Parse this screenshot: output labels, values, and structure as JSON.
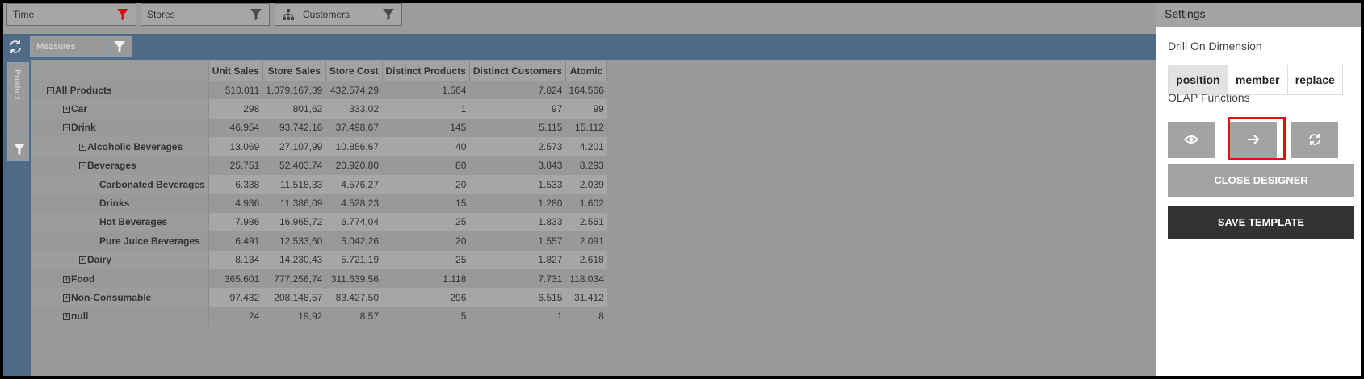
{
  "filters": [
    {
      "label": "Time",
      "icon": "filter-icon",
      "color": "#d0101b"
    },
    {
      "label": "Stores",
      "icon": "filter-icon",
      "color": "#4a4a4a"
    },
    {
      "label": "Customers",
      "icon": "filter-icon",
      "color": "#4a4a4a"
    }
  ],
  "measures_bar": {
    "label": "Measures"
  },
  "left_bar": {
    "product_label": "Product"
  },
  "table": {
    "columns": [
      "Unit Sales",
      "Store Sales",
      "Store Cost",
      "Distinct Products",
      "Distinct Customers",
      "Atomic"
    ],
    "rows": [
      {
        "label": "All Products",
        "toggle": "⊟",
        "level": 0,
        "values": [
          "510.011",
          "1.079.167,39",
          "432.574,29",
          "1.564",
          "7.824",
          "164.566"
        ]
      },
      {
        "label": "Car",
        "toggle": "⊞",
        "level": 1,
        "values": [
          "298",
          "801,62",
          "333,02",
          "1",
          "97",
          "99"
        ]
      },
      {
        "label": "Drink",
        "toggle": "⊟",
        "level": 1,
        "values": [
          "46.954",
          "93.742,16",
          "37.498,67",
          "145",
          "5.115",
          "15.112"
        ]
      },
      {
        "label": "Alcoholic Beverages",
        "toggle": "⊞",
        "level": 2,
        "values": [
          "13.069",
          "27.107,99",
          "10.856,67",
          "40",
          "2.573",
          "4.201"
        ]
      },
      {
        "label": "Beverages",
        "toggle": "⊟",
        "level": 2,
        "values": [
          "25.751",
          "52.403,74",
          "20.920,80",
          "80",
          "3.843",
          "8.293"
        ]
      },
      {
        "label": "Carbonated Beverages",
        "toggle": "",
        "level": 3,
        "values": [
          "6.338",
          "11.518,33",
          "4.576,27",
          "20",
          "1.533",
          "2.039"
        ]
      },
      {
        "label": "Drinks",
        "toggle": "",
        "level": 3,
        "values": [
          "4.936",
          "11.386,09",
          "4.528,23",
          "15",
          "1.280",
          "1.602"
        ]
      },
      {
        "label": "Hot Beverages",
        "toggle": "",
        "level": 3,
        "values": [
          "7.986",
          "16.965,72",
          "6.774,04",
          "25",
          "1.833",
          "2.561"
        ]
      },
      {
        "label": "Pure Juice Beverages",
        "toggle": "",
        "level": 3,
        "values": [
          "6.491",
          "12.533,60",
          "5.042,26",
          "20",
          "1.557",
          "2.091"
        ]
      },
      {
        "label": "Dairy",
        "toggle": "⊞",
        "level": 2,
        "values": [
          "8.134",
          "14.230,43",
          "5.721,19",
          "25",
          "1.827",
          "2.618"
        ]
      },
      {
        "label": "Food",
        "toggle": "⊞",
        "level": 1,
        "values": [
          "365.601",
          "777.256,74",
          "311.639,56",
          "1.118",
          "7.731",
          "118.034"
        ]
      },
      {
        "label": "Non-Consumable",
        "toggle": "⊞",
        "level": 1,
        "values": [
          "97.432",
          "208.148,57",
          "83.427,50",
          "296",
          "6.515",
          "31.412"
        ]
      },
      {
        "label": "null",
        "toggle": "⊞",
        "level": 1,
        "values": [
          "24",
          "19,92",
          "8,57",
          "5",
          "1",
          "8"
        ]
      }
    ]
  },
  "settings": {
    "title": "Settings",
    "drill_label": "Drill On Dimension",
    "drill_options": [
      "position",
      "member",
      "replace"
    ],
    "drill_selected": "position",
    "olap_label": "OLAP Functions",
    "olap_buttons": [
      "eye-icon",
      "arrow-right-icon",
      "refresh-icon"
    ],
    "highlighted_button": "arrow-right-icon",
    "close_designer": "CLOSE DESIGNER",
    "save_template": "SAVE TEMPLATE"
  }
}
